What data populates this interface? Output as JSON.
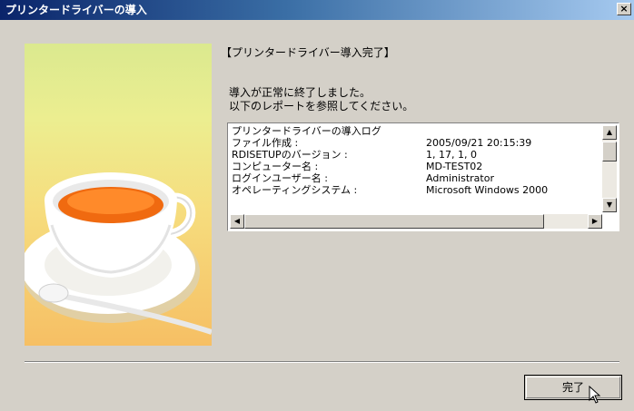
{
  "window": {
    "title": "プリンタードライバーの導入",
    "close_label": "×"
  },
  "content": {
    "heading": "【プリンタードライバー導入完了】",
    "message_lines": [
      "導入が正常に終了しました。",
      "以下のレポートを参照してください。"
    ]
  },
  "log": {
    "rows": [
      {
        "label": "プリンタードライバーの導入ログ",
        "value": ""
      },
      {
        "label": "ファイル作成 :",
        "value": "2005/09/21 20:15:39"
      },
      {
        "label": "RDISETUPのバージョン :",
        "value": "1, 17, 1, 0"
      },
      {
        "label": "コンピューター名 :",
        "value": "MD-TEST02"
      },
      {
        "label": "ログインユーザー名 :",
        "value": "Administrator"
      },
      {
        "label": "オペレーティングシステム :",
        "value": "Microsoft Windows 2000"
      }
    ]
  },
  "footer": {
    "finish_label": "完了"
  },
  "icons": {
    "illustration": "teacup-illustration",
    "close": "close-icon",
    "cursor": "mouse-pointer-icon"
  }
}
